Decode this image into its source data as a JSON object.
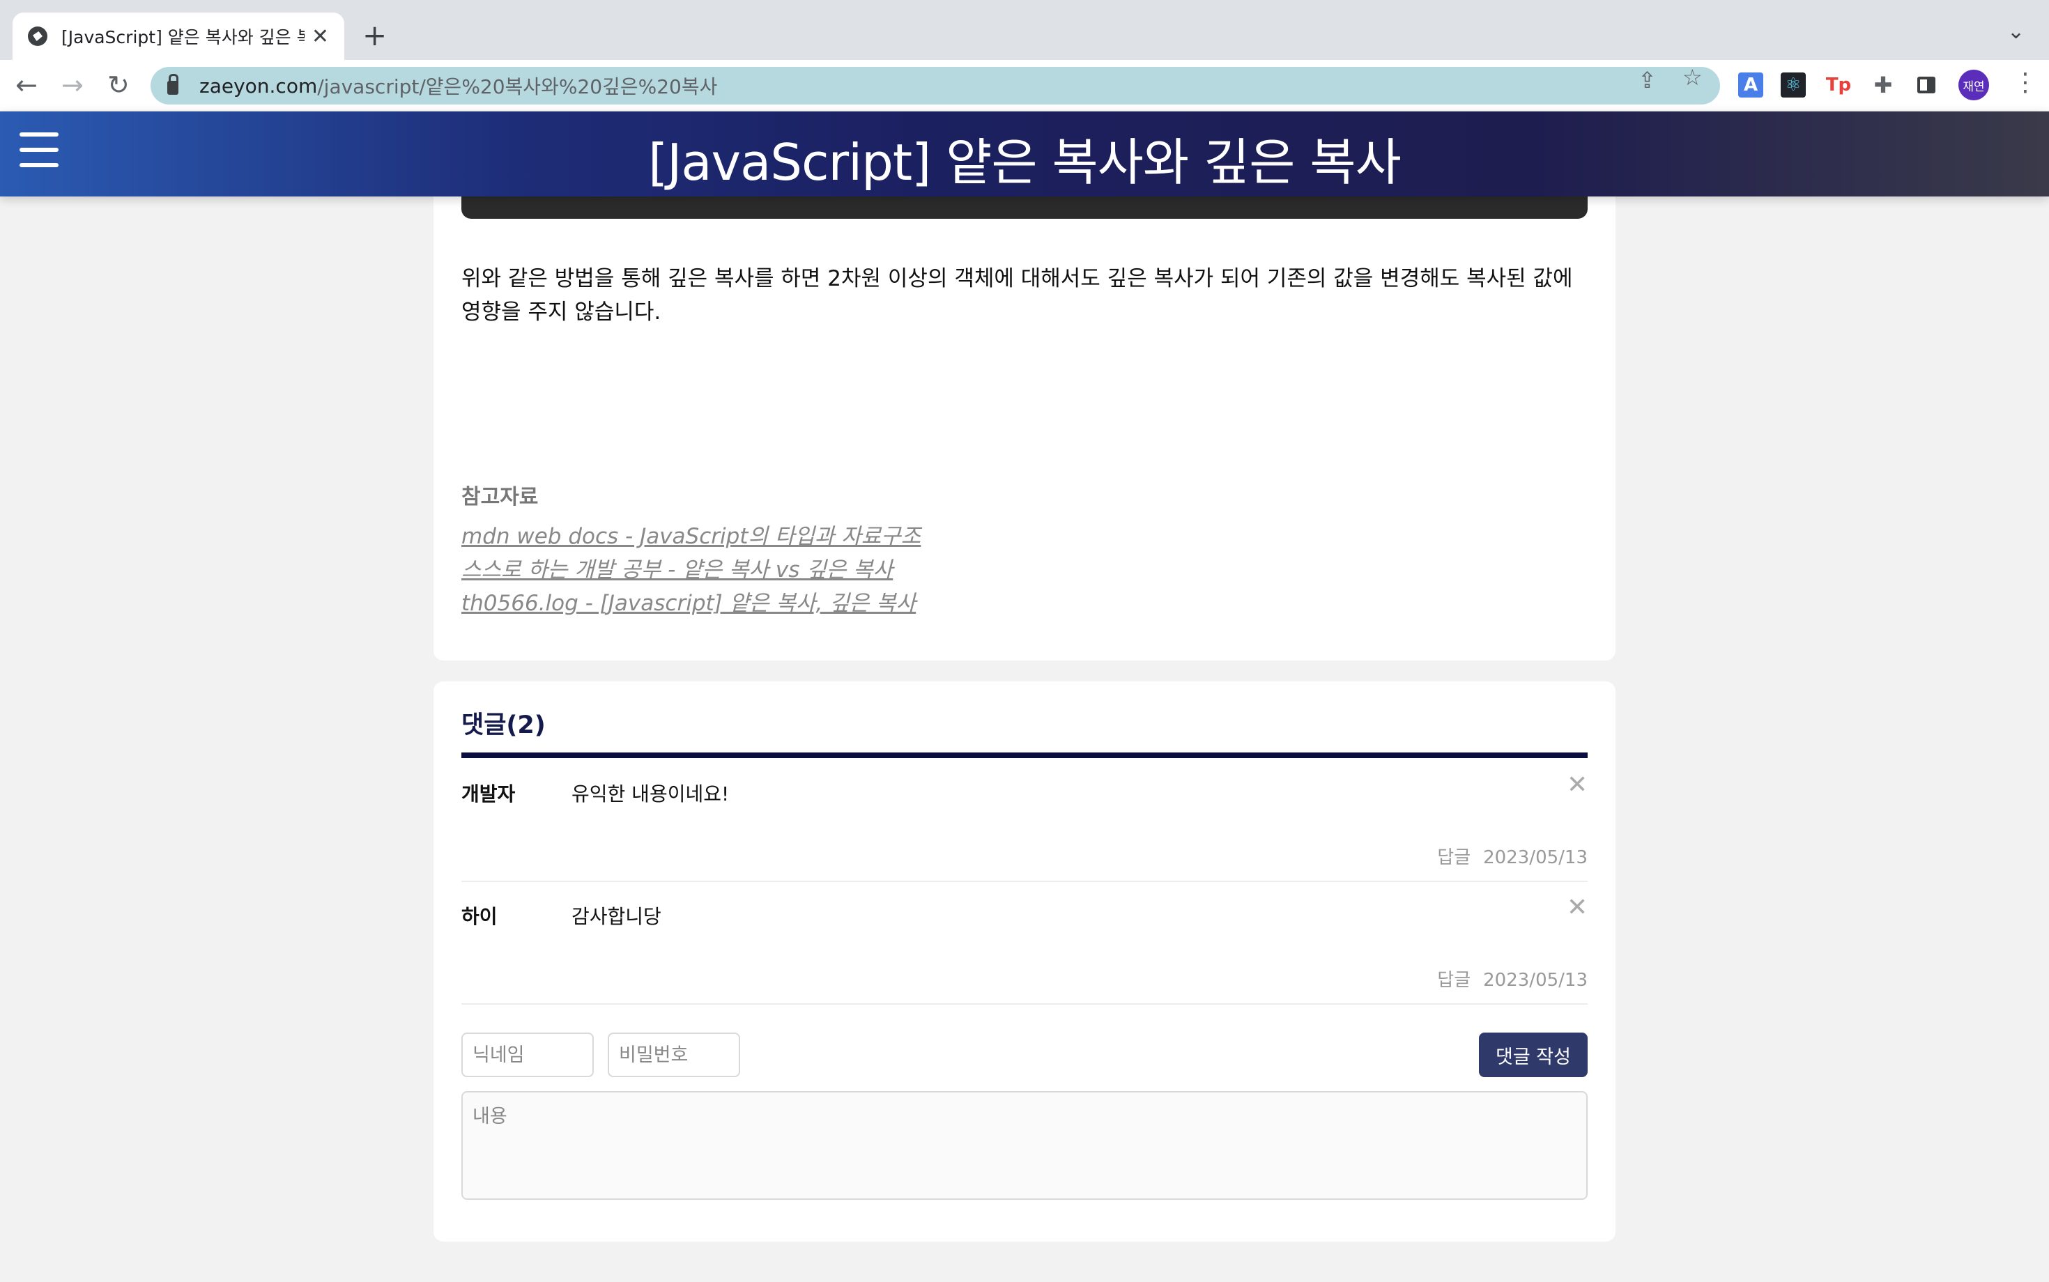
{
  "browser": {
    "tab_title": "[JavaScript] 얕은 복사와 깊은 복사",
    "url_domain": "zaeyon.com",
    "url_path": "/javascript/얕은%20복사와%20깊은%20복사",
    "profile_initials": "재연",
    "extensions": [
      "translate-icon",
      "react-devtools-icon",
      "tp-icon",
      "puzzle-icon",
      "sidepanel-icon"
    ]
  },
  "header": {
    "title": "[JavaScript] 얕은 복사와 깊은 복사"
  },
  "article": {
    "paragraph": "위와 같은 방법을 통해 깊은 복사를 하면 2차원 이상의 객체에 대해서도 깊은 복사가 되어 기존의 값을 변경해도 복사된 값에 영향을 주지 않습니다.",
    "references_title": "참고자료",
    "references": [
      "mdn web docs - JavaScript의 타입과 자료구조",
      "스스로 하는 개발 공부 - 얕은 복사 vs 깊은 복사",
      "th0566.log - [Javascript] 얕은 복사, 깊은 복사"
    ]
  },
  "comments": {
    "title": "댓글(2)",
    "items": [
      {
        "author": "개발자",
        "text": "유익한 내용이네요!",
        "reply_label": "답글",
        "date": "2023/05/13"
      },
      {
        "author": "하이",
        "text": "감사합니당",
        "reply_label": "답글",
        "date": "2023/05/13"
      }
    ],
    "form": {
      "nickname_placeholder": "닉네임",
      "password_placeholder": "비밀번호",
      "content_placeholder": "내용",
      "submit_label": "댓글 작성"
    }
  }
}
